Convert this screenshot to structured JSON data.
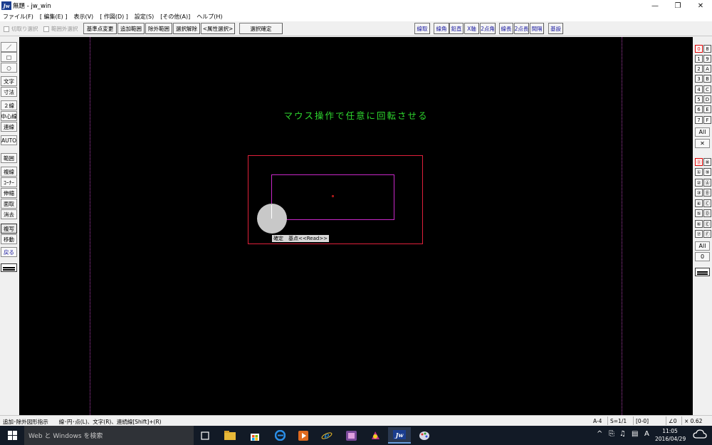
{
  "window": {
    "title": "無題 - jw_win",
    "app_icon_text": "Jw",
    "minimize": "—",
    "maximize": "❐",
    "close": "✕"
  },
  "menu": [
    "ファイル(F)",
    "[ 編集(E) ]",
    "表示(V)",
    "[ 作図(D) ]",
    "設定(S)",
    "[その他(A)]",
    "ヘルプ(H)"
  ],
  "toolbar": {
    "checkbox_kirinuki": "切取り選択",
    "checkbox_hanigai": "範囲外選択",
    "btn_kijunten": "基準点変更",
    "btn_tsuika": "追加範囲",
    "btn_jogai": "除外範囲",
    "btn_sentaku_kaijo": "選択解除",
    "btn_zokusei": "<属性選択>",
    "btn_sentaku_kakutei": "選択確定",
    "btn_senshu": "線取",
    "btn_senkaku": "線角",
    "btn_enchoku": "鉛直",
    "btn_xjiku": "X軸",
    "btn_2tenkaku": "2点角",
    "btn_senchou": "線長",
    "btn_2tenchou": "2点長",
    "btn_kankaku": "間隔",
    "btn_kijaku": "基設"
  },
  "left_tools": {
    "line": "／",
    "rect": "□",
    "circle": "○",
    "text": "文字",
    "dim": "寸法",
    "double": "２線",
    "center": "中心線",
    "continuous": "連線",
    "auto": "AUTO",
    "range": "範囲",
    "composite": "複線",
    "corner": "ｺｰﾅｰ",
    "stretch": "伸縮",
    "chamfer": "面取",
    "erase": "消去",
    "copy": "複写",
    "move": "移動",
    "undo": "戻る"
  },
  "layers": {
    "group_labels": [
      "0",
      "8",
      "1",
      "9",
      "2",
      "A",
      "3",
      "B",
      "4",
      "C",
      "5",
      "D",
      "6",
      "E",
      "7",
      "F"
    ],
    "group_all": "All",
    "group_x": "✕",
    "layer_labels": [
      "⓪",
      "⑧",
      "①",
      "⑨",
      "②",
      "Ⓐ",
      "③",
      "Ⓑ",
      "④",
      "Ⓒ",
      "⑤",
      "Ⓓ",
      "⑥",
      "Ⓔ",
      "⑦",
      "Ⓕ"
    ],
    "layer_all": "All",
    "layer_zero": "0"
  },
  "canvas": {
    "hint": "マウス操作で任意に回転させる",
    "tooltip": "確定　基点<<Read>>"
  },
  "status": {
    "message": "追加･除外図形指示　　線･円･点(L)、文字(R)、連続線[Shift]+(R)",
    "paper": "A-4",
    "scale": "S=1/1",
    "layer": "[0-0]",
    "angle": "∠0",
    "zoom": "× 0.62"
  },
  "taskbar": {
    "search_placeholder": "Web と Windows を検索",
    "time": "11:05",
    "date": "2016/04/29",
    "ime": "A"
  },
  "colors": {
    "canvas_bg": "#000000",
    "hint_text": "#2ed62e",
    "selection_frame": "#e0203a",
    "selected_shape": "#c828c8",
    "taskbar_bg": "#121a26"
  }
}
